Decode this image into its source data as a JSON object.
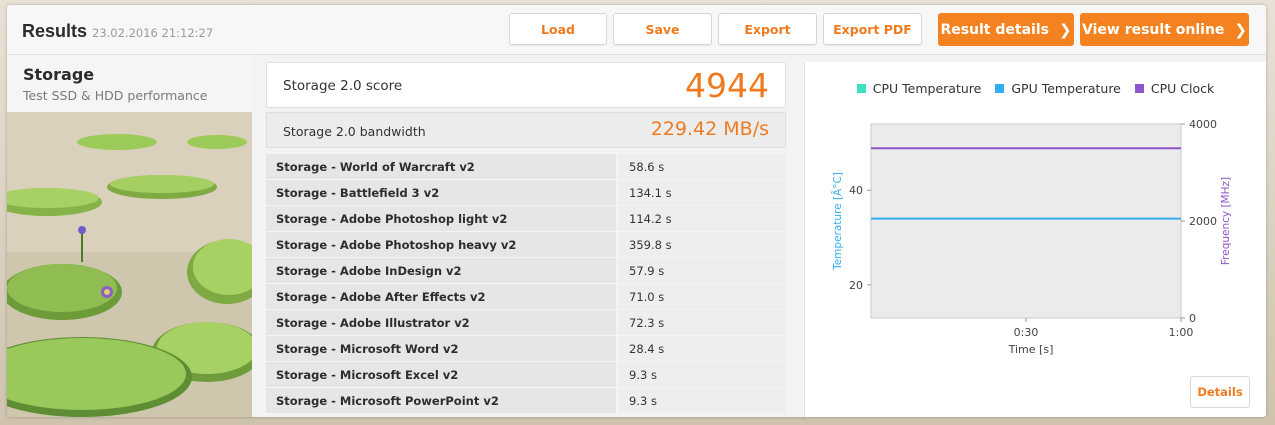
{
  "header": {
    "title": "Results",
    "date": "23.02.2016 21:12:27",
    "buttons": {
      "load": "Load",
      "save": "Save",
      "export": "Export",
      "export_pdf": "Export PDF",
      "result_details": "Result details",
      "view_online": "View result online"
    }
  },
  "benchmark": {
    "name": "Storage",
    "description": "Test SSD & HDD performance"
  },
  "score": {
    "label": "Storage 2.0 score",
    "value": "4944"
  },
  "bandwidth": {
    "label": "Storage 2.0 bandwidth",
    "value": "229.42 MB/s"
  },
  "subtests": [
    {
      "name": "Storage - World of Warcraft v2",
      "value": "58.6 s"
    },
    {
      "name": "Storage - Battlefield 3 v2",
      "value": "134.1 s"
    },
    {
      "name": "Storage - Adobe Photoshop light v2",
      "value": "114.2 s"
    },
    {
      "name": "Storage - Adobe Photoshop heavy v2",
      "value": "359.8 s"
    },
    {
      "name": "Storage - Adobe InDesign v2",
      "value": "57.9 s"
    },
    {
      "name": "Storage - Adobe After Effects v2",
      "value": "71.0 s"
    },
    {
      "name": "Storage - Adobe Illustrator v2",
      "value": "72.3 s"
    },
    {
      "name": "Storage - Microsoft Word v2",
      "value": "28.4 s"
    },
    {
      "name": "Storage - Microsoft Excel v2",
      "value": "9.3 s"
    },
    {
      "name": "Storage - Microsoft PowerPoint v2",
      "value": "9.3 s"
    }
  ],
  "chart_data": {
    "type": "line",
    "legend": [
      {
        "name": "CPU Temperature",
        "color": "#3de0c2"
      },
      {
        "name": "GPU Temperature",
        "color": "#33aef0"
      },
      {
        "name": "CPU Clock",
        "color": "#8f56c9"
      }
    ],
    "xlabel": "Time [s]",
    "ylabel_left": "Temperature [Â°C]",
    "ylabel_right": "Frequency [MHz]",
    "x_ticks": [
      "0:30",
      "1:00"
    ],
    "x_range": [
      0,
      60
    ],
    "y_left_ticks": [
      "40",
      "20"
    ],
    "y_left_range": [
      13,
      54
    ],
    "y_right_ticks": [
      "4000",
      "2000",
      "0"
    ],
    "y_right_range": [
      0,
      4000
    ],
    "series": [
      {
        "name": "GPU Temperature",
        "axis": "left",
        "x": [
          0,
          60
        ],
        "y": [
          34,
          34
        ]
      },
      {
        "name": "CPU Clock",
        "axis": "right",
        "x": [
          0,
          60
        ],
        "y": [
          3500,
          3500
        ]
      }
    ],
    "grid": false
  },
  "details_button": "Details"
}
